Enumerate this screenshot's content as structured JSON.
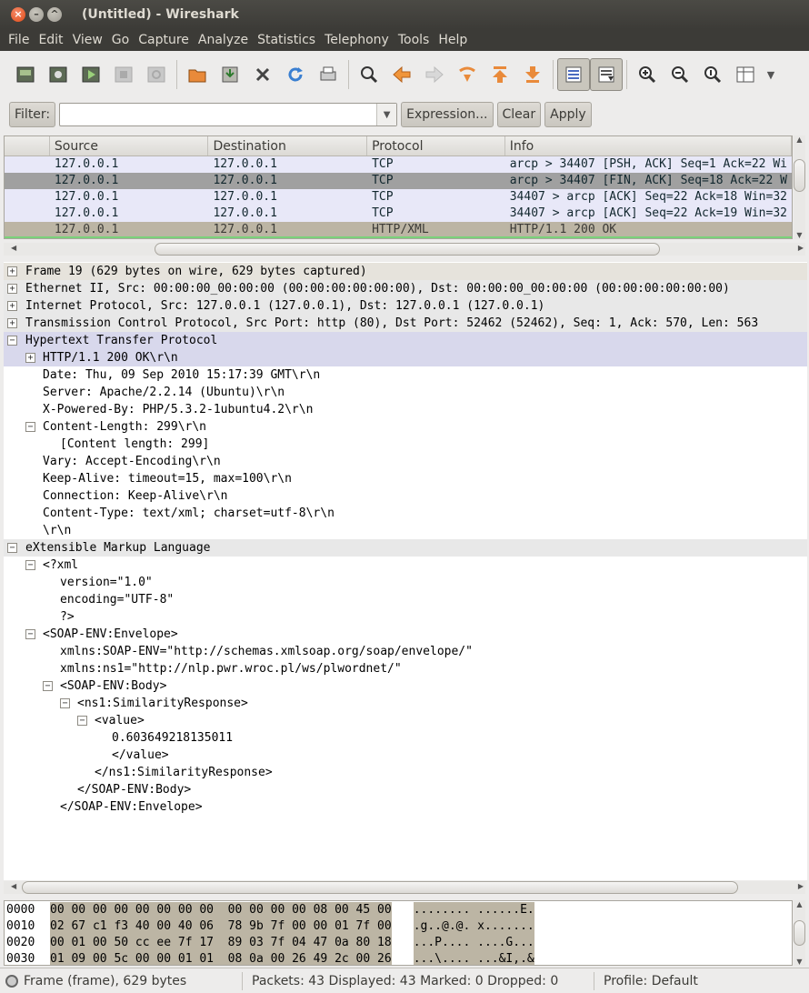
{
  "window": {
    "title": "(Untitled) - Wireshark"
  },
  "menu": [
    "File",
    "Edit",
    "View",
    "Go",
    "Capture",
    "Analyze",
    "Statistics",
    "Telephony",
    "Tools",
    "Help"
  ],
  "filter": {
    "label": "Filter:",
    "value": "",
    "expression": "Expression...",
    "clear": "Clear",
    "apply": "Apply"
  },
  "packet_list": {
    "columns": [
      "Source",
      "Destination",
      "Protocol",
      "Info"
    ],
    "rows": [
      {
        "src": "127.0.0.1",
        "dst": "127.0.0.1",
        "proto": "TCP",
        "info": "arcp > 34407 [PSH, ACK] Seq=1 Ack=22 Wi",
        "bg": "#e8e8f8",
        "fg": "#12272e"
      },
      {
        "src": "127.0.0.1",
        "dst": "127.0.0.1",
        "proto": "TCP",
        "info": "arcp > 34407 [FIN, ACK] Seq=18 Ack=22 W",
        "bg": "#a0a0a0",
        "fg": "#12272e"
      },
      {
        "src": "127.0.0.1",
        "dst": "127.0.0.1",
        "proto": "TCP",
        "info": "34407 > arcp [ACK] Seq=22 Ack=18 Win=32",
        "bg": "#e8e8f8",
        "fg": "#12272e"
      },
      {
        "src": "127.0.0.1",
        "dst": "127.0.0.1",
        "proto": "TCP",
        "info": "34407 > arcp [ACK] Seq=22 Ack=19 Win=32",
        "bg": "#e8e8f8",
        "fg": "#12272e"
      },
      {
        "src": "127.0.0.1",
        "dst": "127.0.0.1",
        "proto": "HTTP/XML",
        "info": "HTTP/1.1 200 OK",
        "bg": "#bcb5a4",
        "fg": "#3c3b37"
      }
    ]
  },
  "details": [
    {
      "indent": 0,
      "exp": "+",
      "text": "Frame 19 (629 bytes on wire, 629 bytes captured)",
      "bg": "#e6e3dc"
    },
    {
      "indent": 0,
      "exp": "+",
      "text": "Ethernet II, Src: 00:00:00_00:00:00 (00:00:00:00:00:00), Dst: 00:00:00_00:00:00 (00:00:00:00:00:00)",
      "bg": "#e8e8e8"
    },
    {
      "indent": 0,
      "exp": "+",
      "text": "Internet Protocol, Src: 127.0.0.1 (127.0.0.1), Dst: 127.0.0.1 (127.0.0.1)",
      "bg": "#e8e8e8"
    },
    {
      "indent": 0,
      "exp": "+",
      "text": "Transmission Control Protocol, Src Port: http (80), Dst Port: 52462 (52462), Seq: 1, Ack: 570, Len: 563",
      "bg": "#e8e8e8"
    },
    {
      "indent": 0,
      "exp": "-",
      "text": "Hypertext Transfer Protocol",
      "bg": "#d8d8ec"
    },
    {
      "indent": 1,
      "exp": "+",
      "text": "HTTP/1.1 200 OK\\r\\n",
      "bg": "#d8d8ec"
    },
    {
      "indent": 1,
      "exp": "",
      "text": "Date: Thu, 09 Sep 2010 15:17:39 GMT\\r\\n",
      "bg": ""
    },
    {
      "indent": 1,
      "exp": "",
      "text": "Server: Apache/2.2.14 (Ubuntu)\\r\\n",
      "bg": ""
    },
    {
      "indent": 1,
      "exp": "",
      "text": "X-Powered-By: PHP/5.3.2-1ubuntu4.2\\r\\n",
      "bg": ""
    },
    {
      "indent": 1,
      "exp": "-",
      "text": "Content-Length: 299\\r\\n",
      "bg": ""
    },
    {
      "indent": 2,
      "exp": "",
      "text": "[Content length: 299]",
      "bg": ""
    },
    {
      "indent": 1,
      "exp": "",
      "text": "Vary: Accept-Encoding\\r\\n",
      "bg": ""
    },
    {
      "indent": 1,
      "exp": "",
      "text": "Keep-Alive: timeout=15, max=100\\r\\n",
      "bg": ""
    },
    {
      "indent": 1,
      "exp": "",
      "text": "Connection: Keep-Alive\\r\\n",
      "bg": ""
    },
    {
      "indent": 1,
      "exp": "",
      "text": "Content-Type: text/xml; charset=utf-8\\r\\n",
      "bg": ""
    },
    {
      "indent": 1,
      "exp": "",
      "text": "\\r\\n",
      "bg": ""
    },
    {
      "indent": 0,
      "exp": "-",
      "text": "eXtensible Markup Language",
      "bg": "#e8e8e8"
    },
    {
      "indent": 1,
      "exp": "-",
      "text": "<?xml",
      "bg": ""
    },
    {
      "indent": 2,
      "exp": "",
      "text": "version=\"1.0\"",
      "bg": ""
    },
    {
      "indent": 2,
      "exp": "",
      "text": "encoding=\"UTF-8\"",
      "bg": ""
    },
    {
      "indent": 2,
      "exp": "",
      "text": "?>",
      "bg": ""
    },
    {
      "indent": 1,
      "exp": "-",
      "text": "<SOAP-ENV:Envelope>",
      "bg": ""
    },
    {
      "indent": 2,
      "exp": "",
      "text": "xmlns:SOAP-ENV=\"http://schemas.xmlsoap.org/soap/envelope/\"",
      "bg": ""
    },
    {
      "indent": 2,
      "exp": "",
      "text": "xmlns:ns1=\"http://nlp.pwr.wroc.pl/ws/plwordnet/\"",
      "bg": ""
    },
    {
      "indent": 2,
      "exp": "-",
      "text": "<SOAP-ENV:Body>",
      "bg": ""
    },
    {
      "indent": 3,
      "exp": "-",
      "text": "<ns1:SimilarityResponse>",
      "bg": ""
    },
    {
      "indent": 4,
      "exp": "-",
      "text": "<value>",
      "bg": ""
    },
    {
      "indent": 5,
      "exp": "",
      "text": "0.603649218135011",
      "bg": ""
    },
    {
      "indent": 5,
      "exp": "",
      "text": "</value>",
      "bg": ""
    },
    {
      "indent": 4,
      "exp": "",
      "text": "</ns1:SimilarityResponse>",
      "bg": ""
    },
    {
      "indent": 3,
      "exp": "",
      "text": "</SOAP-ENV:Body>",
      "bg": ""
    },
    {
      "indent": 2,
      "exp": "",
      "text": "</SOAP-ENV:Envelope>",
      "bg": ""
    }
  ],
  "hex": [
    {
      "off": "0000",
      "bytes": "00 00 00 00 00 00 00 00  00 00 00 00 08 00 45 00",
      "ascii": "........ ......E."
    },
    {
      "off": "0010",
      "bytes": "02 67 c1 f3 40 00 40 06  78 9b 7f 00 00 01 7f 00",
      "ascii": ".g..@.@. x......."
    },
    {
      "off": "0020",
      "bytes": "00 01 00 50 cc ee 7f 17  89 03 7f 04 47 0a 80 18",
      "ascii": "...P.... ....G..."
    },
    {
      "off": "0030",
      "bytes": "01 09 00 5c 00 00 01 01  08 0a 00 26 49 2c 00 26",
      "ascii": "...\\.... ...&I,.&"
    }
  ],
  "status": {
    "frame": "Frame (frame), 629 bytes",
    "packets": "Packets: 43 Displayed: 43 Marked: 0 Dropped: 0",
    "profile": "Profile: Default"
  }
}
